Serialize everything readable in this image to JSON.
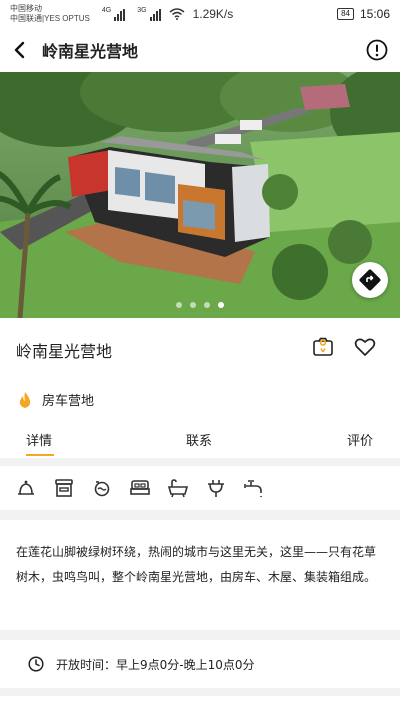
{
  "status_bar": {
    "carrier_1": "中国移动",
    "carrier_2": "中国联通|YES OPTUS",
    "net_1": "4G",
    "net_2": "3G",
    "speed": "1.29K/s",
    "battery": "84",
    "time": "15:06"
  },
  "nav": {
    "title": "岭南星光营地",
    "back_icon": "chevron-left-icon",
    "info_icon": "exclamation-circle-icon"
  },
  "hero": {
    "image_subject": "container-house-campsite-aerial",
    "slide_count": 4,
    "active_slide": 3,
    "fab_icon": "directions-icon"
  },
  "place": {
    "name": "岭南星光营地",
    "camera_icon": "camera-location-icon",
    "favorite_icon": "heart-outline-icon"
  },
  "category": {
    "icon": "campfire-icon",
    "label": "房车营地",
    "icon_color": "#f5a623"
  },
  "tabs": [
    {
      "label": "详情",
      "active": true
    },
    {
      "label": "联系",
      "active": false
    },
    {
      "label": "评价",
      "active": false
    }
  ],
  "facilities": [
    "bell-icon",
    "shop-icon",
    "laundry-icon",
    "bed-icon",
    "bath-icon",
    "power-plug-icon",
    "water-tap-icon"
  ],
  "description": "在莲花山脚被绿树环绕，热闹的城市与这里无关，这里——只有花草树木，虫鸣鸟叫，整个岭南星光营地，由房车、木屋、集装箱组成。",
  "hours": {
    "icon": "clock-icon",
    "text": "开放时间：早上9点0分-晚上10点0分"
  },
  "colors": {
    "accent": "#f5a623",
    "text": "#222222",
    "background": "#f2f2f2"
  }
}
